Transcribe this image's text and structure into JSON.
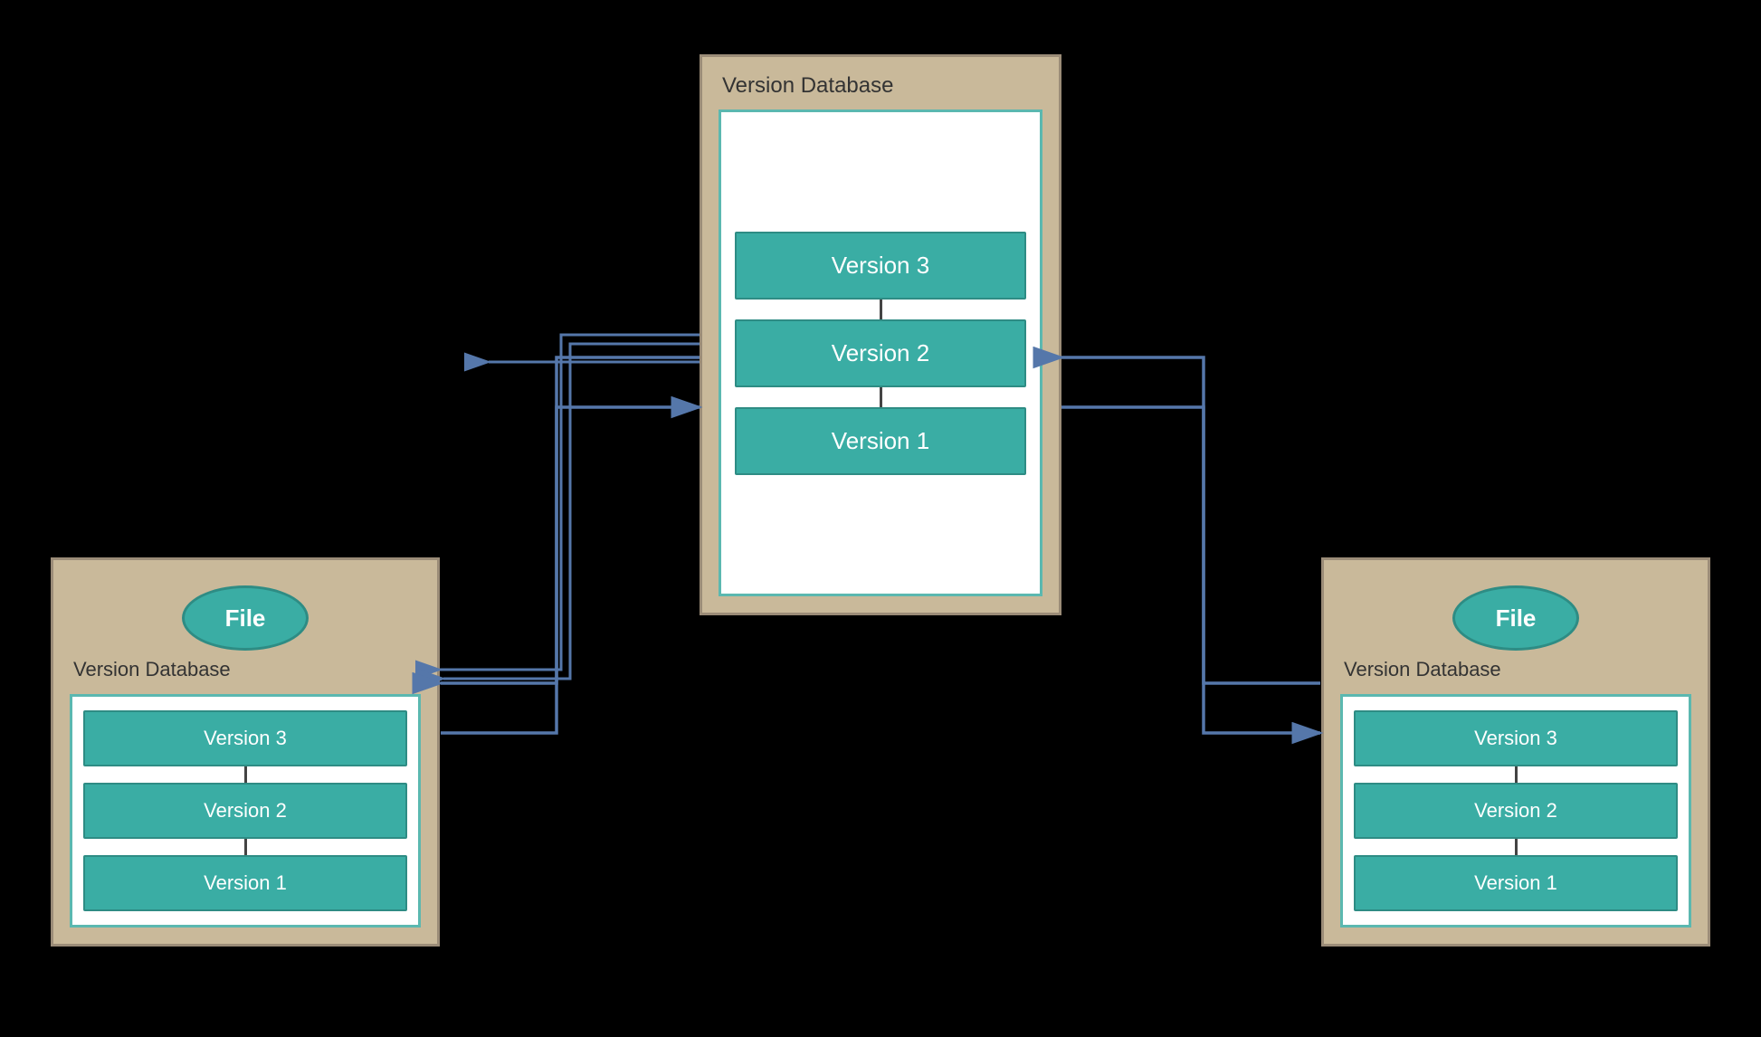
{
  "diagram": {
    "background": "#000000",
    "center": {
      "label": "Version Database",
      "versions": [
        "Version 3",
        "Version 2",
        "Version 1"
      ]
    },
    "left": {
      "label": "Version Database",
      "file_label": "File",
      "versions": [
        "Version 3",
        "Version 2",
        "Version 1"
      ]
    },
    "right": {
      "label": "Version Database",
      "file_label": "File",
      "versions": [
        "Version 3",
        "Version 2",
        "Version 1"
      ]
    },
    "arrows": {
      "center_to_left": "push from center to left",
      "left_to_center": "pull from left to center",
      "center_to_right": "push from center to right",
      "right_to_center": "pull from right to center"
    }
  }
}
